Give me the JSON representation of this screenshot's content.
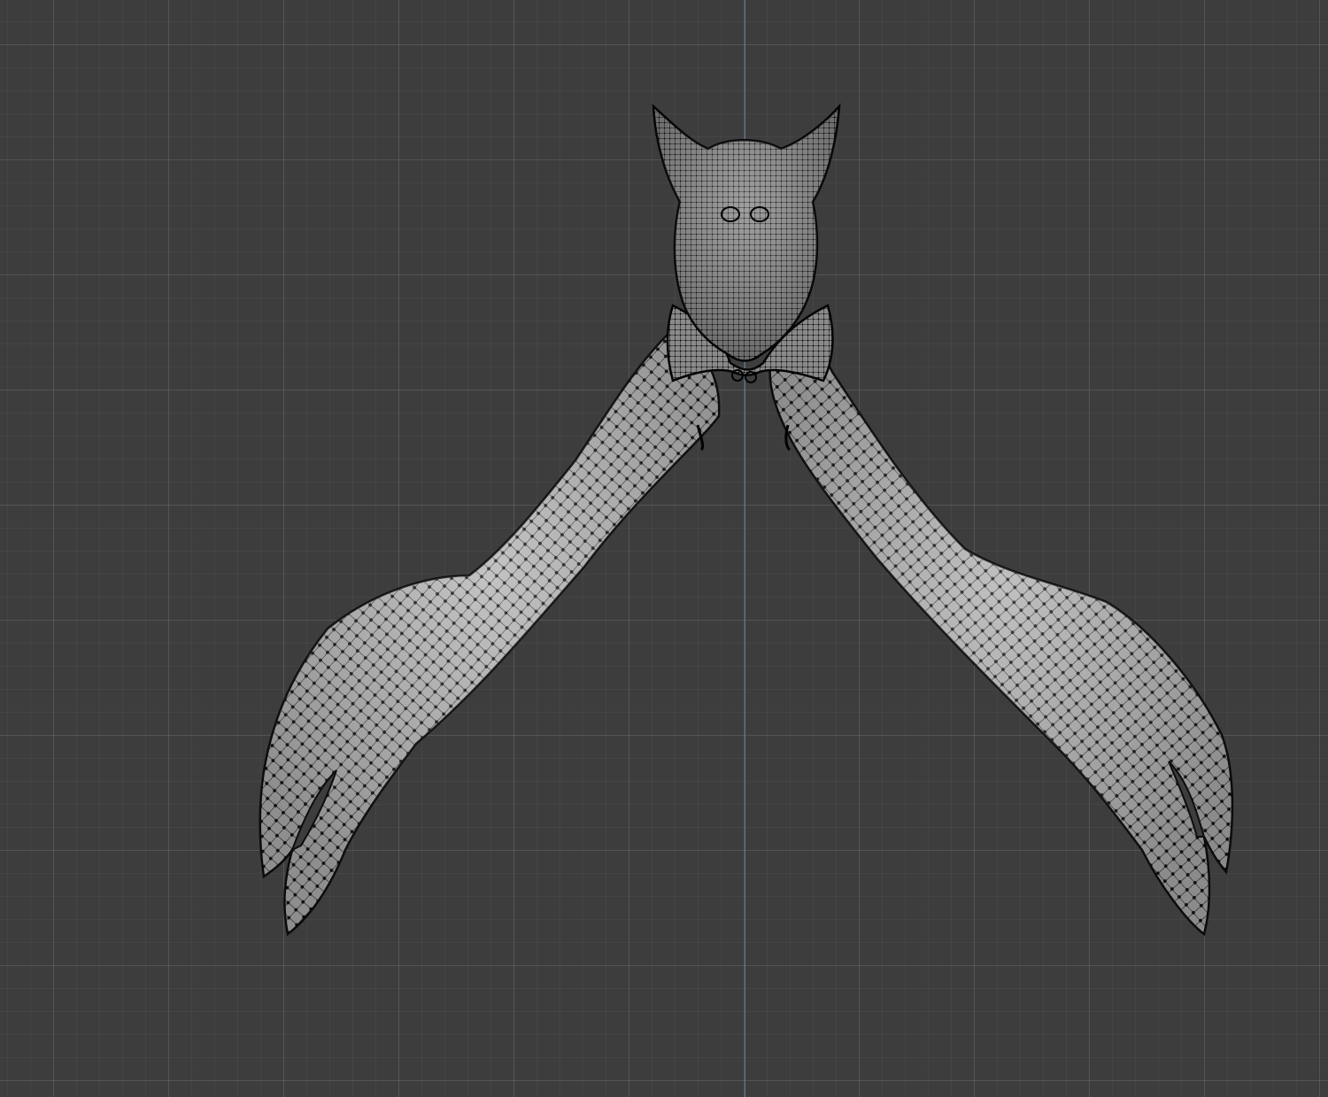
{
  "viewport": {
    "background_color": "#3d3d3d",
    "y_axis_color": "#4f7fa8",
    "mesh_fill_color": "#b4b4b4",
    "wire_color": "#111111"
  },
  "object": {
    "icon": "wireframe-mesh-icon"
  }
}
